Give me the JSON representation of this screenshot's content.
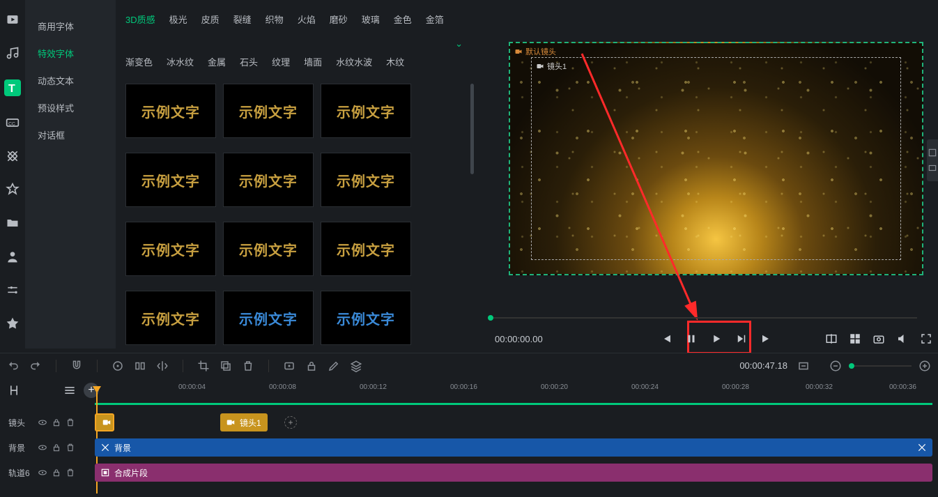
{
  "sidebar": {
    "categories": [
      "商用字体",
      "特效字体",
      "动态文本",
      "预设样式",
      "对话框"
    ],
    "activeIndex": 1
  },
  "tabs_row1": [
    "3D质感",
    "极光",
    "皮质",
    "裂缝",
    "织物",
    "火焰",
    "磨砂",
    "玻璃",
    "金色",
    "金箔"
  ],
  "tabs_row2": [
    "渐变色",
    "冰水纹",
    "金属",
    "石头",
    "纹理",
    "墙面",
    "水纹水波",
    "木纹"
  ],
  "tabs_active": "3D质感",
  "thumb_text": "示例文字",
  "preview": {
    "outer_label": "默认镜头",
    "inner_label": "镜头1",
    "timecode": "00:00:00.00"
  },
  "toolbar_timecode": "00:00:47.18",
  "ruler_ticks": [
    "00:00:04",
    "00:00:08",
    "00:00:12",
    "00:00:16",
    "00:00:20",
    "00:00:24",
    "00:00:28",
    "00:00:32",
    "00:00:36"
  ],
  "tracks": {
    "shot": {
      "label": "镜头",
      "clip_label": "镜头1"
    },
    "bg": {
      "label": "背景",
      "clip_label": "背景"
    },
    "track6": {
      "label": "轨道6",
      "clip_label": "合成片段"
    }
  },
  "icons": {
    "video": "video-icon",
    "music": "music-icon",
    "text": "text-icon",
    "cc": "cc-icon",
    "texture": "texture-icon",
    "plugin": "plugin-icon",
    "folder": "folder-icon",
    "person": "person-icon",
    "adjust": "adjust-icon",
    "star": "star-icon"
  }
}
